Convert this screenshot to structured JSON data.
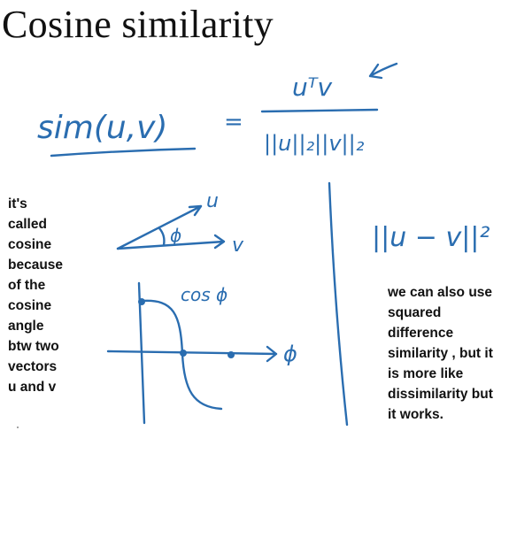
{
  "title": "Cosine similarity",
  "colors": {
    "ink": "#2a6db0",
    "text": "#111111",
    "background": "#ffffff"
  },
  "handwriting": {
    "formula_lhs": "sim(u,v)",
    "equals": "=",
    "numerator": "uᵀv",
    "denominator": "||u||₂||v||₂",
    "vector_u": "u",
    "vector_v": "v",
    "angle": "ϕ",
    "cos_label": "cos ϕ",
    "axis_label": "ϕ",
    "squared_diff": "||u − v||²"
  },
  "notes": {
    "left": [
      "it's",
      "called",
      "cosine",
      "because",
      "of the",
      "cosine",
      "angle",
      "btw two",
      "vectors",
      "u and v"
    ],
    "right": [
      "we can also use",
      "squared",
      "difference",
      "similarity , but it",
      "is more like",
      "dissimilarity but",
      "it works."
    ]
  }
}
